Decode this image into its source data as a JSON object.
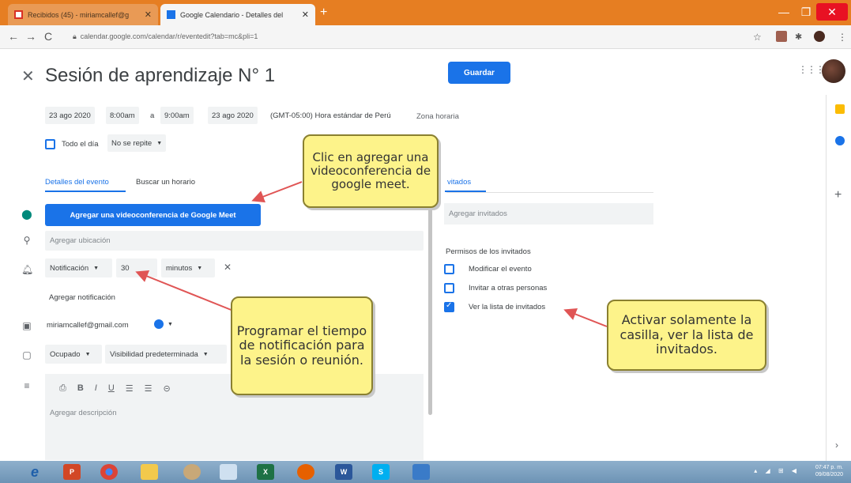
{
  "browser": {
    "tabs": [
      {
        "label": "Recibidos (45) - miriamcallef@g",
        "active": false
      },
      {
        "label": "Google Calendario - Detalles del",
        "active": true
      }
    ],
    "url": "calendar.google.com/calendar/r/eventedit?tab=mc&pli=1"
  },
  "header": {
    "title": "Sesión de aprendizaje N° 1",
    "save_label": "Guardar"
  },
  "datetime": {
    "start_date": "23 ago 2020",
    "start_time": "8:00am",
    "separator": "a",
    "end_time": "9:00am",
    "end_date": "23 ago 2020",
    "timezone_text": "(GMT-05:00) Hora estándar de Perú",
    "timezone_link": "Zona horaria",
    "all_day_label": "Todo el día",
    "repeat_label": "No se repite"
  },
  "tabs": {
    "details": "Detalles del evento",
    "find_time": "Buscar un horario",
    "guests": "vitados"
  },
  "details": {
    "meet_button": "Agregar una videoconferencia de Google Meet",
    "location_placeholder": "Agregar ubicación",
    "notification_type": "Notificación",
    "notification_value": "30",
    "notification_unit": "minutos",
    "add_notification": "Agregar notificación",
    "calendar_owner": "miriamcallef@gmail.com",
    "busy_status": "Ocupado",
    "visibility": "Visibilidad predeterminada",
    "description_placeholder": "Agregar descripción"
  },
  "guests": {
    "input_placeholder": "Agregar invitados",
    "permissions_title": "Permisos de los invitados",
    "permissions": [
      {
        "label": "Modificar el evento",
        "checked": false
      },
      {
        "label": "Invitar a otras personas",
        "checked": false
      },
      {
        "label": "Ver la lista de invitados",
        "checked": true
      }
    ]
  },
  "callouts": {
    "meet": "Clic en agregar una videoconferencia de google meet.",
    "notification": "Programar el tiempo de notificación para la sesión o reunión.",
    "guests": "Activar solamente la casilla, ver la lista de invitados."
  },
  "taskbar": {
    "time": "07:47 p. m.",
    "date": "09/08/2020"
  },
  "colors": {
    "accent": "#1a73e8",
    "callout_bg": "#fdf38a",
    "arrow": "#e05555",
    "tabbar": "#e67e22"
  }
}
